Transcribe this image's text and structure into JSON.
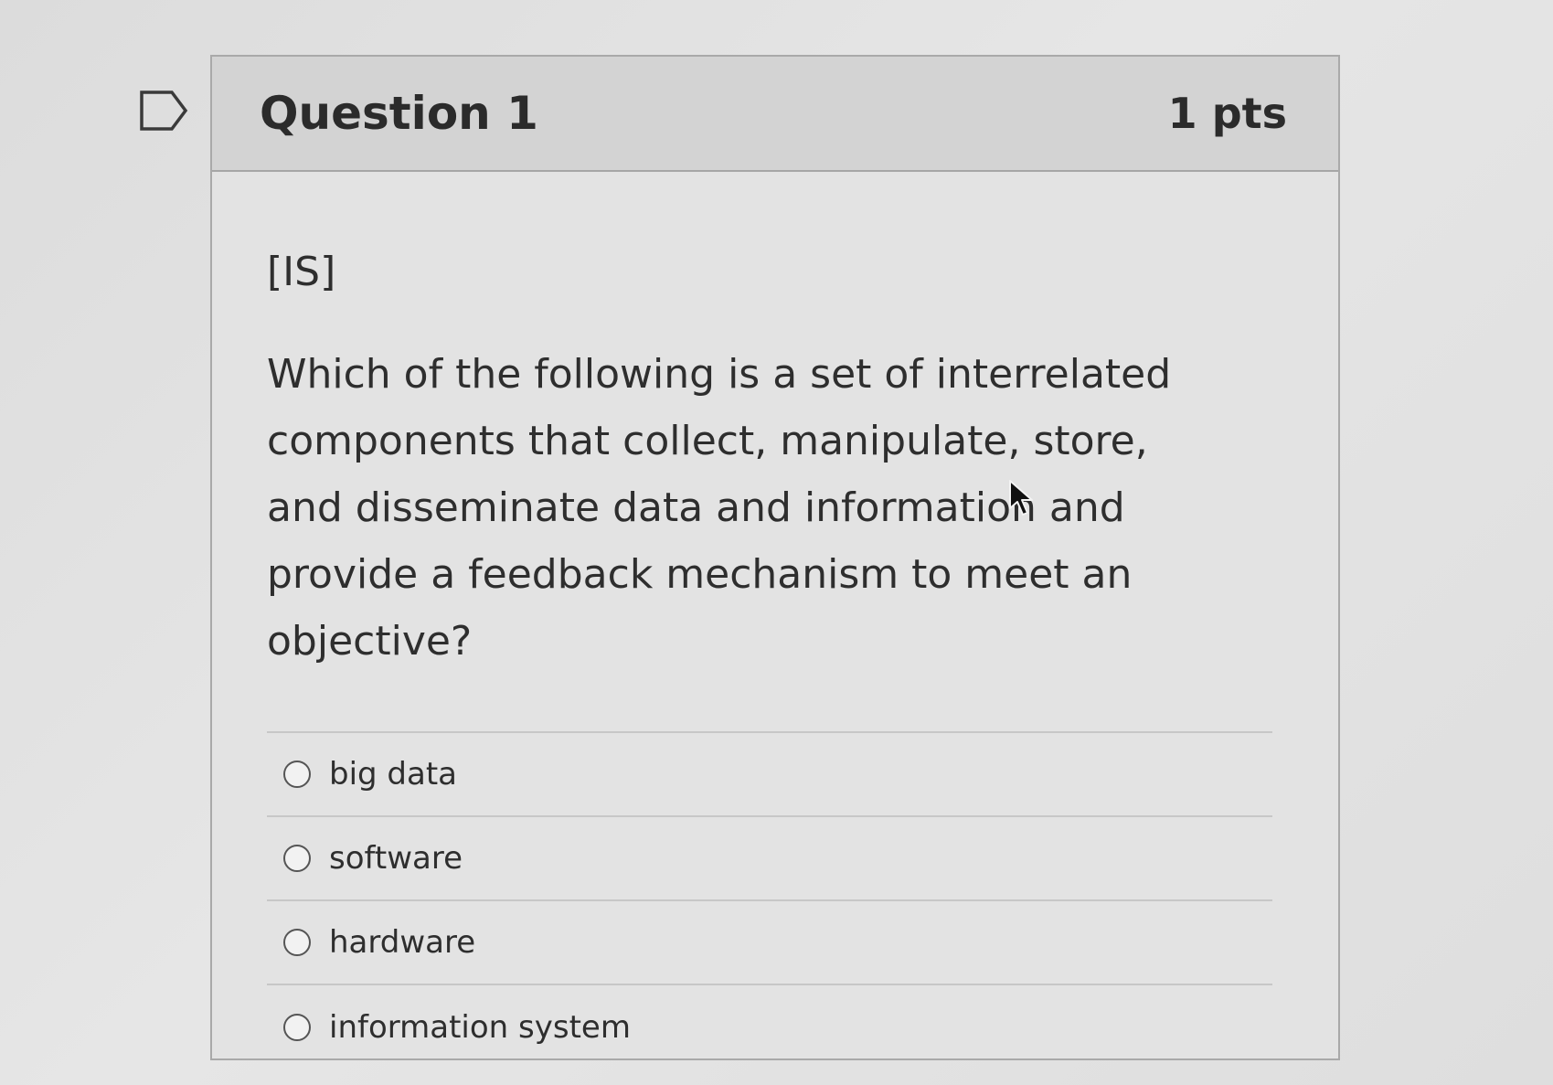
{
  "question": {
    "title": "Question 1",
    "points": "1 pts",
    "tag": "[IS]",
    "text": "Which of the following is a set of interrelated components that collect, manipulate, store, and disseminate data and information and provide a feedback mechanism to meet an objective?",
    "answers": [
      {
        "label": "big data"
      },
      {
        "label": "software"
      },
      {
        "label": "hardware"
      },
      {
        "label": "information system"
      }
    ]
  },
  "icons": {
    "flag": "flag-question-icon",
    "cursor": "mouse-pointer-icon"
  },
  "colors": {
    "header_bg": "#d3d3d3",
    "card_bg": "#e3e3e3",
    "text": "#2e2e2e"
  }
}
